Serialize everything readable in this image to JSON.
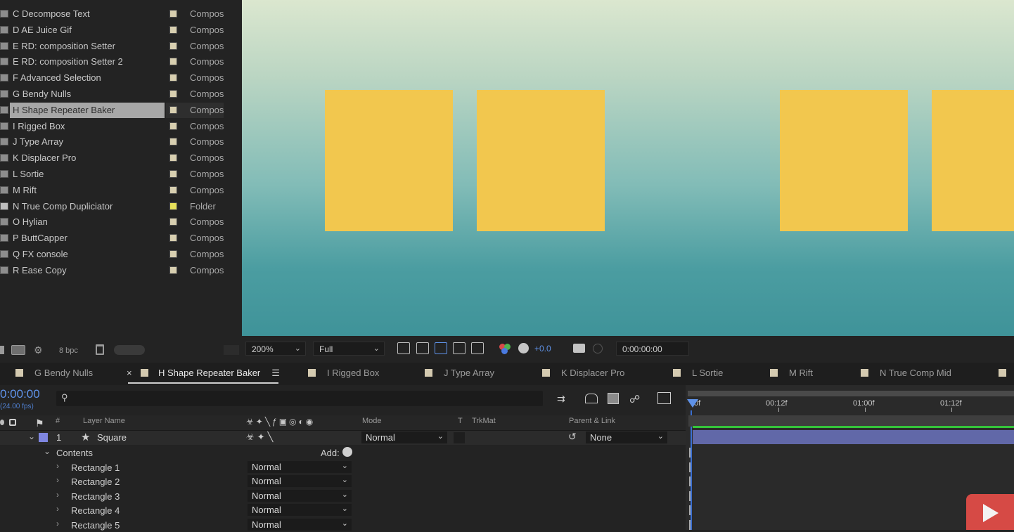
{
  "project": {
    "items": [
      {
        "name": "C Decompose Text",
        "type": "Compos"
      },
      {
        "name": "D AE Juice Gif",
        "type": "Compos"
      },
      {
        "name": "E RD: composition Setter",
        "type": "Compos"
      },
      {
        "name": "E RD: composition Setter 2",
        "type": "Compos"
      },
      {
        "name": "F Advanced Selection",
        "type": "Compos"
      },
      {
        "name": "G Bendy Nulls",
        "type": "Compos"
      },
      {
        "name": "H Shape Repeater Baker",
        "type": "Compos",
        "selected": true
      },
      {
        "name": "I Rigged Box",
        "type": "Compos"
      },
      {
        "name": "J Type Array",
        "type": "Compos"
      },
      {
        "name": "K Displacer Pro",
        "type": "Compos"
      },
      {
        "name": "L Sortie",
        "type": "Compos"
      },
      {
        "name": "M Rift",
        "type": "Compos"
      },
      {
        "name": "N True Comp Dupliciator",
        "type": "Folder"
      },
      {
        "name": "O Hylian",
        "type": "Compos"
      },
      {
        "name": "P ButtCapper",
        "type": "Compos"
      },
      {
        "name": "Q FX console",
        "type": "Compos"
      },
      {
        "name": "R Ease Copy",
        "type": "Compos"
      }
    ],
    "bpc": "8 bpc"
  },
  "viewer": {
    "zoom": "200%",
    "resolution": "Full",
    "exposure": "+0.0",
    "timecode": "0:00:00:00",
    "square_color": "#f2c74e"
  },
  "tabs": [
    {
      "label": "G Bendy Nulls"
    },
    {
      "label": "H Shape Repeater Baker",
      "active": true
    },
    {
      "label": "I Rigged Box"
    },
    {
      "label": "J Type Array"
    },
    {
      "label": "K Displacer Pro"
    },
    {
      "label": "L Sortie"
    },
    {
      "label": "M Rift"
    },
    {
      "label": "N True Comp Mid"
    }
  ],
  "timeline": {
    "current_time": "0:00:00",
    "fps": "(24.00 fps)",
    "columns": {
      "number": "#",
      "layer_name": "Layer Name",
      "mode": "Mode",
      "t": "T",
      "trkmat": "TrkMat",
      "parent": "Parent & Link"
    },
    "ruler": [
      "0f",
      "00:12f",
      "01:00f",
      "01:12f"
    ],
    "layer": {
      "index": "1",
      "name": "Square",
      "mode": "Normal",
      "parent": "None"
    },
    "contents_label": "Contents",
    "add_label": "Add:",
    "rectangles": [
      {
        "name": "Rectangle 1",
        "mode": "Normal"
      },
      {
        "name": "Rectangle 2",
        "mode": "Normal"
      },
      {
        "name": "Rectangle 3",
        "mode": "Normal"
      },
      {
        "name": "Rectangle 4",
        "mode": "Normal"
      },
      {
        "name": "Rectangle 5",
        "mode": "Normal"
      }
    ]
  }
}
